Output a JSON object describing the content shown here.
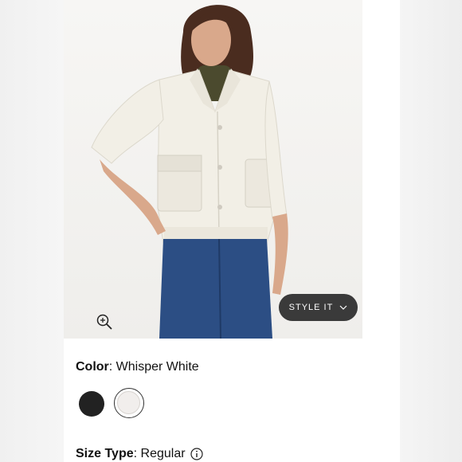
{
  "product": {
    "style_it_label": "STYLE IT",
    "color_label": "Color",
    "color_value": "Whisper White",
    "size_type_label": "Size Type",
    "size_type_value": "Regular"
  },
  "swatches": [
    {
      "name": "black",
      "hex": "#222222"
    },
    {
      "name": "whisper-white",
      "hex": "#f1eeec"
    }
  ],
  "colors": {
    "accent_pill": "#3a3a3a",
    "jacket": "#f2efe6",
    "jeans": "#2c4e84"
  }
}
